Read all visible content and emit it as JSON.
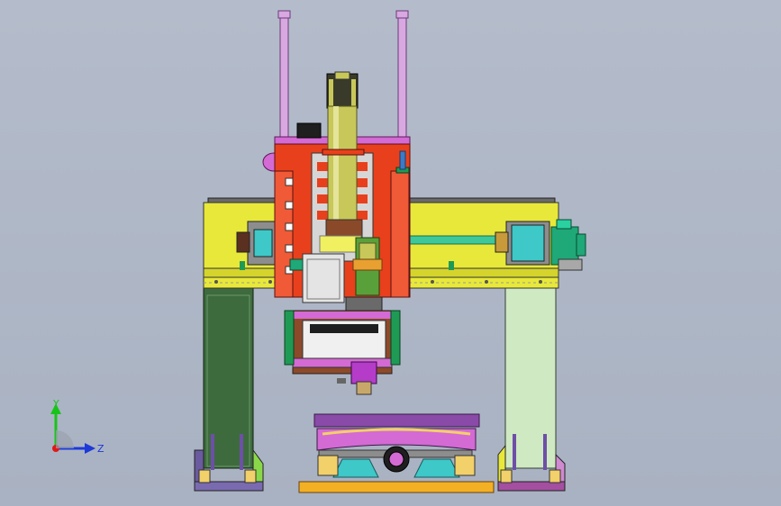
{
  "viewport": {
    "background_top": "#b4bccb",
    "background_bottom": "#a9b2c2"
  },
  "triad": {
    "y_label": "Y",
    "z_label": "Z",
    "y_color": "#19c419",
    "z_color": "#1d39d8",
    "x_color": "#e01818"
  },
  "colors": {
    "beam_yellow": "#e8e83a",
    "column_left": "#3e6b3e",
    "column_right": "#cfe9c2",
    "carriage_red": "#e8401c",
    "spindle_olive": "#c8c85a",
    "magenta": "#d46ad4",
    "cyan": "#3ec8c8",
    "base_orange": "#f2b024",
    "purple": "#7a3a9a"
  }
}
